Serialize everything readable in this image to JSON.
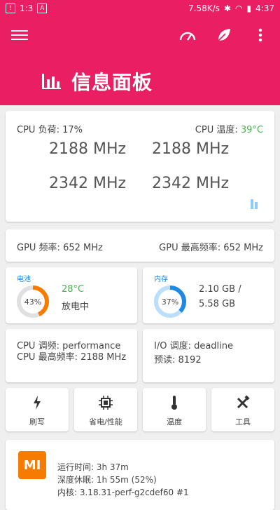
{
  "statusbar": {
    "left_text": "1:3",
    "speed": "7.58K/s",
    "time": "4:37"
  },
  "appbar": {
    "title": "信息面板",
    "actions": [
      "speedometer-icon",
      "leaf-icon",
      "more-vert-icon"
    ]
  },
  "cpu": {
    "load_label": "CPU 负荷: 17%",
    "temp_label": "CPU 温度: ",
    "temp_value": "39°C",
    "freqs": [
      "2188 MHz",
      "2188 MHz",
      "2342 MHz",
      "2342 MHz"
    ]
  },
  "gpu": {
    "freq": "GPU 频率: 652 MHz",
    "max_freq": "GPU 最高频率: 652 MHz"
  },
  "battery": {
    "title": "电池",
    "percent_text": "43%",
    "percent": 43,
    "temp": "28°C",
    "status": "放电中"
  },
  "memory": {
    "title": "内存",
    "percent_text": "37%",
    "percent": 37,
    "used": "2.10 GB /",
    "total": "5.58 GB"
  },
  "governor": {
    "line1": "CPU 调频: performance",
    "line2": "CPU 最高频率: 2188 MHz"
  },
  "io": {
    "line1": "I/O 调度: deadline",
    "line2": "预读: 8192"
  },
  "tools": [
    {
      "label": "刷写",
      "icon": "flash-icon"
    },
    {
      "label": "省电/性能",
      "icon": "chip-icon"
    },
    {
      "label": "温度",
      "icon": "thermometer-icon"
    },
    {
      "label": "工具",
      "icon": "tools-icon"
    }
  ],
  "device": {
    "logo": "MI",
    "uptime": "运行时间: 3h 37m",
    "deep_sleep": "深度休眠: 1h 55m  (52%)",
    "kernel": "内核: 3.18.31-perf-g2cdef60 #1"
  },
  "colors": {
    "accent": "#e91e63",
    "battery_ring": "#f57c00",
    "memory_ring": "#1e88e5",
    "temp_ok": "#4caf50"
  }
}
